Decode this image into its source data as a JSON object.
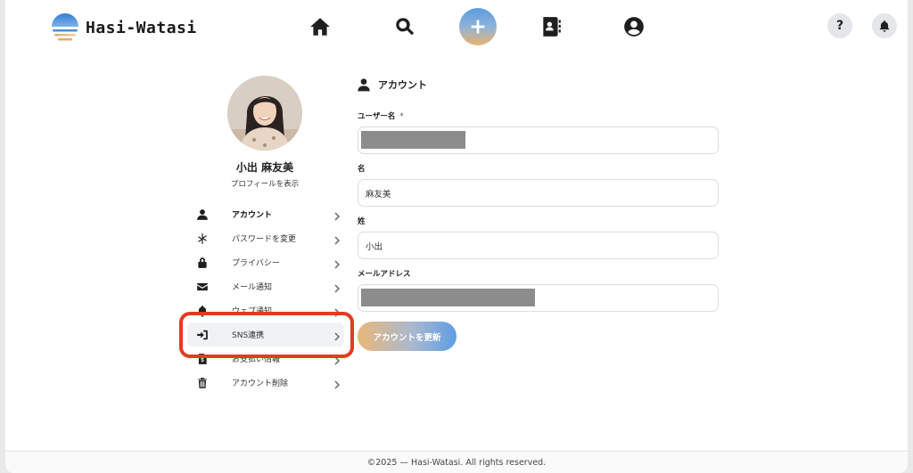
{
  "header": {
    "brand": "Hasi-Watasi",
    "help_label": "?",
    "nav_icons": [
      "home-icon",
      "search-icon",
      "plus-icon",
      "contacts-icon",
      "account-circle-icon"
    ],
    "accent_gradient": [
      "#5a9be0",
      "#e8b36f"
    ]
  },
  "profile": {
    "name": "小出 麻友美",
    "view_profile": "プロフィールを表示"
  },
  "menu": {
    "items": [
      {
        "label": "アカウント",
        "icon": "person-icon",
        "active": true
      },
      {
        "label": "パスワードを変更",
        "icon": "asterisk-icon"
      },
      {
        "label": "プライバシー",
        "icon": "lock-icon"
      },
      {
        "label": "メール通知",
        "icon": "envelope-icon"
      },
      {
        "label": "ウェブ通知",
        "icon": "bell-icon"
      },
      {
        "label": "SNS連携",
        "icon": "sign-in-icon",
        "highlighted": true
      },
      {
        "label": "お支払い情報",
        "icon": "dollar-file-icon"
      },
      {
        "label": "アカウント削除",
        "icon": "trash-icon"
      }
    ],
    "highlight_color": "#e53b1f"
  },
  "form": {
    "title": "アカウント",
    "username_label": "ユーザー名",
    "required_mark": "*",
    "first_name_label": "名",
    "first_name_value": "麻友美",
    "last_name_label": "姓",
    "last_name_value": "小出",
    "email_label": "メールアドレス",
    "submit_label": "アカウントを更新"
  },
  "footer": {
    "copyright": "©2025 — Hasi-Watasi. All rights reserved."
  }
}
